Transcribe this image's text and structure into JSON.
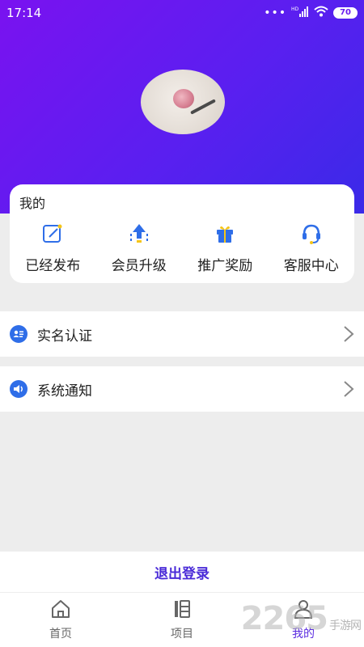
{
  "status_bar": {
    "time": "17:14",
    "dots": "•••",
    "network": "HD",
    "battery": "70"
  },
  "profile": {
    "avatar_icon": "user-avatar"
  },
  "card": {
    "title": "我的",
    "items": [
      {
        "label": "已经发布",
        "icon": "edit-icon",
        "color": "#2f6ee8"
      },
      {
        "label": "会员升级",
        "icon": "upgrade-arrow-icon",
        "color": "#2f6ee8"
      },
      {
        "label": "推广奖励",
        "icon": "gift-icon",
        "color": "#2f6ee8"
      },
      {
        "label": "客服中心",
        "icon": "headset-icon",
        "color": "#2f6ee8"
      }
    ]
  },
  "rows": [
    {
      "label": "实名认证",
      "icon": "id-card-icon"
    },
    {
      "label": "系统通知",
      "icon": "speaker-icon"
    }
  ],
  "logout": {
    "label": "退出登录"
  },
  "tabs": [
    {
      "label": "首页",
      "icon": "home-icon",
      "active": false
    },
    {
      "label": "项目",
      "icon": "project-icon",
      "active": false
    },
    {
      "label": "我的",
      "icon": "user-icon",
      "active": true
    }
  ],
  "watermark": {
    "text": "2265",
    "sub": "手游网"
  },
  "colors": {
    "accent": "#5a2be0",
    "icon_blue": "#2f6ee8",
    "gradient_start": "#7a12f0",
    "gradient_end": "#3a2ae8"
  }
}
